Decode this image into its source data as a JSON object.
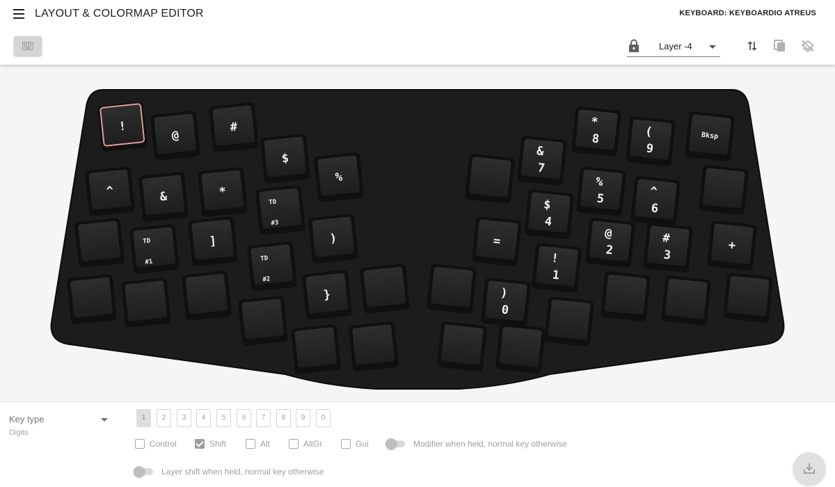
{
  "app": {
    "title": "LAYOUT & COLORMAP EDITOR",
    "keyboard": "KEYBOARD: KEYBOARDIO ATREUS",
    "layer": "Layer -4"
  },
  "icons": {
    "menu": "menu-icon",
    "keyboard_toggle": "keyboard-icon",
    "lock": "lock-icon",
    "import_export": "swap-vertical-icon",
    "copy": "copy-icon",
    "clear": "layers-clear-icon",
    "download": "download-icon"
  },
  "colors": {
    "accent_selected_key": "#e39a9a",
    "keyboard_body": "#1c1c1c"
  },
  "keys": [
    {
      "label": "!"
    },
    {
      "label": "@"
    },
    {
      "label": "#"
    },
    {
      "label": "$"
    },
    {
      "label": "%"
    },
    {
      "label": "^"
    },
    {
      "label": "&"
    },
    {
      "label": "*"
    },
    {
      "label": "TD",
      "sub": "#3"
    },
    {
      "label": ")"
    },
    {
      "label": ""
    },
    {
      "label": "TD",
      "sub": "#1"
    },
    {
      "label": "]"
    },
    {
      "label": "TD",
      "sub": "#2"
    },
    {
      "label": "}"
    },
    {
      "label": ""
    },
    {
      "label": ""
    },
    {
      "label": ""
    },
    {
      "label": ""
    },
    {
      "label": ""
    },
    {
      "label": ""
    },
    {
      "label": ""
    },
    {
      "label": "&",
      "sub": "7"
    },
    {
      "label": "*",
      "sub": "8"
    },
    {
      "label": "(",
      "sub": "9"
    },
    {
      "label": "Bksp"
    },
    {
      "label": ""
    },
    {
      "label": "$",
      "sub": "4"
    },
    {
      "label": "%",
      "sub": "5"
    },
    {
      "label": "^",
      "sub": "6"
    },
    {
      "label": ""
    },
    {
      "label": "="
    },
    {
      "label": "!",
      "sub": "1"
    },
    {
      "label": "@",
      "sub": "2"
    },
    {
      "label": "#",
      "sub": "3"
    },
    {
      "label": "+"
    },
    {
      "label": ""
    },
    {
      "label": ")",
      "sub": "0"
    },
    {
      "label": ""
    },
    {
      "label": ""
    },
    {
      "label": ""
    },
    {
      "label": ""
    },
    {
      "label": ""
    },
    {
      "label": ""
    }
  ],
  "editor": {
    "key_type_label": "Key type",
    "key_type_value": "Digits",
    "digits": [
      "1",
      "2",
      "3",
      "4",
      "5",
      "6",
      "7",
      "8",
      "9",
      "0"
    ],
    "selected_digit": "1",
    "modifiers": [
      {
        "label": "Control",
        "checked": false
      },
      {
        "label": "Shift",
        "checked": true
      },
      {
        "label": "Alt",
        "checked": false
      },
      {
        "label": "AltGr",
        "checked": false
      },
      {
        "label": "Gui",
        "checked": false
      }
    ],
    "modifier_toggle_label": "Modifier when held, normal key otherwise",
    "layer_toggle_label": "Layer shift when held, normal key otherwise"
  }
}
